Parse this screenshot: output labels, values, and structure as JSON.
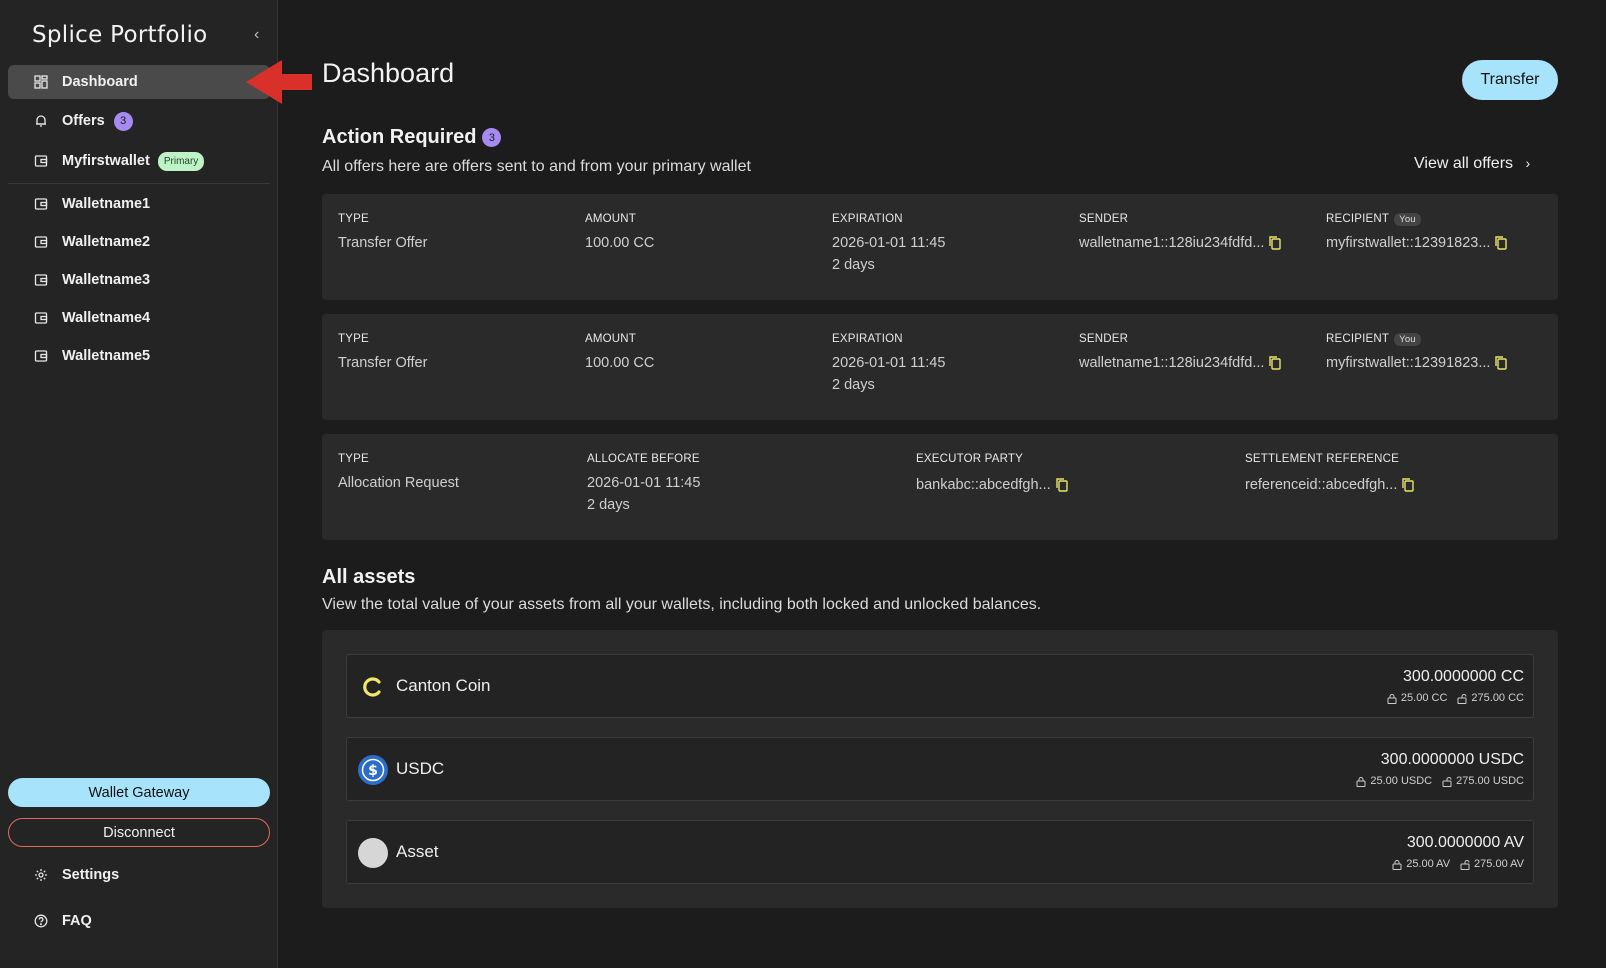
{
  "sidebar": {
    "brand": "Splice Portfolio",
    "collapse_glyph": "‹",
    "items": [
      {
        "label": "Dashboard",
        "icon": "grid-icon"
      },
      {
        "label": "Offers",
        "icon": "bell-icon",
        "badge": "3"
      },
      {
        "label": "Myfirstwallet",
        "icon": "wallet-icon",
        "badge": "Primary"
      },
      {
        "label": "Walletname1",
        "icon": "wallet-icon"
      },
      {
        "label": "Walletname2",
        "icon": "wallet-icon"
      },
      {
        "label": "Walletname3",
        "icon": "wallet-icon"
      },
      {
        "label": "Walletname4",
        "icon": "wallet-icon"
      },
      {
        "label": "Walletname5",
        "icon": "wallet-icon"
      }
    ],
    "gateway_label": "Wallet Gateway",
    "disconnect_label": "Disconnect",
    "settings_label": "Settings",
    "faq_label": "FAQ"
  },
  "main": {
    "title": "Dashboard",
    "transfer_label": "Transfer",
    "action_required": {
      "title": "Action Required",
      "count": "3",
      "subtitle": "All offers here are offers sent to and from your primary wallet",
      "view_all": "View all offers",
      "offers": [
        {
          "type_label": "TYPE",
          "type": "Transfer Offer",
          "amount_label": "AMOUNT",
          "amount": "100.00 CC",
          "expiration_label": "EXPIRATION",
          "expiration": "2026-01-01 11:45",
          "expiration_rel": "2 days",
          "sender_label": "SENDER",
          "sender": "walletname1::128iu234fdfd...",
          "recipient_label": "RECIPIENT",
          "recipient_badge": "You",
          "recipient": "myfirstwallet::12391823..."
        },
        {
          "type_label": "TYPE",
          "type": "Transfer Offer",
          "amount_label": "AMOUNT",
          "amount": "100.00 CC",
          "expiration_label": "EXPIRATION",
          "expiration": "2026-01-01 11:45",
          "expiration_rel": "2 days",
          "sender_label": "SENDER",
          "sender": "walletname1::128iu234fdfd...",
          "recipient_label": "RECIPIENT",
          "recipient_badge": "You",
          "recipient": "myfirstwallet::12391823..."
        }
      ],
      "allocation": {
        "type_label": "TYPE",
        "type": "Allocation Request",
        "allocate_label": "ALLOCATE BEFORE",
        "allocate": "2026-01-01 11:45",
        "allocate_rel": "2 days",
        "executor_label": "EXECUTOR PARTY",
        "executor": "bankabc::abcedfgh...",
        "settlement_label": "SETTLEMENT REFERENCE",
        "settlement": "referenceid::abcedfgh..."
      }
    },
    "assets": {
      "title": "All assets",
      "subtitle": "View the total value of your assets from all your wallets, including both locked and unlocked balances.",
      "items": [
        {
          "name": "Canton Coin",
          "icon": "canton-coin-icon",
          "total": "300.0000000 CC",
          "locked": "25.00 CC",
          "unlocked": "275.00 CC"
        },
        {
          "name": "USDC",
          "icon": "usdc-icon",
          "total": "300.0000000 USDC",
          "locked": "25.00 USDC",
          "unlocked": "275.00 USDC"
        },
        {
          "name": "Asset",
          "icon": "generic-asset-icon",
          "total": "300.0000000 AV",
          "locked": "25.00 AV",
          "unlocked": "275.00 AV"
        }
      ]
    }
  },
  "colors": {
    "background": "#1c1c1c",
    "sidebar": "#242424",
    "card": "#2a2a2a",
    "accent_blue": "#a7e3fb",
    "badge_purple": "#a58bf0",
    "primary_green": "#bff2c7",
    "copy_yellow": "#e8e46a",
    "annotation_red": "#d9302a"
  }
}
